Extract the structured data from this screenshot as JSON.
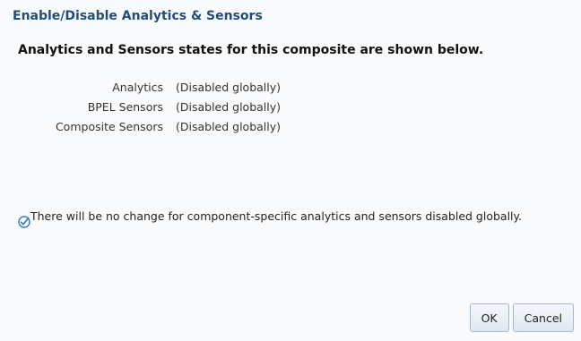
{
  "dialog": {
    "title": "Enable/Disable Analytics & Sensors",
    "intro": "Analytics and Sensors states for this composite are shown below.",
    "states": [
      {
        "label": "Analytics",
        "value": "(Disabled globally)"
      },
      {
        "label": "BPEL Sensors",
        "value": "(Disabled globally)"
      },
      {
        "label": "Composite Sensors",
        "value": "(Disabled globally)"
      }
    ],
    "note": "There will be no change for component-specific analytics and sensors disabled globally.",
    "buttons": {
      "ok": "OK",
      "cancel": "Cancel"
    }
  },
  "icons": {
    "note_icon": "check-badge-icon"
  },
  "colors": {
    "title": "#1f4e79",
    "background": "#f9fafb",
    "button_border": "#a4b8cc",
    "icon_blue": "#3b74c7"
  }
}
